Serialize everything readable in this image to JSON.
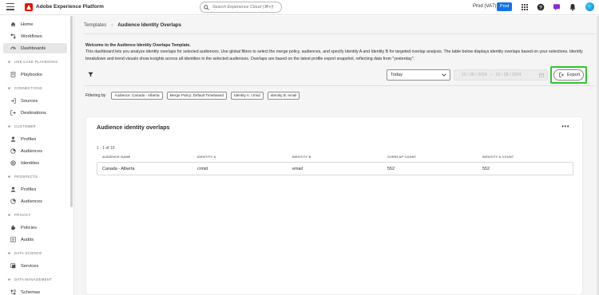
{
  "app": {
    "title": "Adobe Experience Platform",
    "search_placeholder": "Search Experience Cloud (⌘+/)",
    "org": "Prod (VA7)",
    "sandbox_badge": "Prod",
    "accent_color": "#1473e6",
    "brand_color": "#eb1000"
  },
  "sidebar": {
    "items_top": [
      {
        "label": "Home",
        "icon": "home-icon"
      },
      {
        "label": "Workflows",
        "icon": "workflows-icon"
      },
      {
        "label": "Dashboards",
        "icon": "dashboards-icon",
        "active": true
      }
    ],
    "sections": [
      {
        "label": "USE CASE PLAYBOOKS",
        "items": [
          {
            "label": "Playbooks",
            "icon": "playbooks-icon"
          }
        ]
      },
      {
        "label": "CONNECTIONS",
        "items": [
          {
            "label": "Sources",
            "icon": "sources-icon"
          },
          {
            "label": "Destinations",
            "icon": "destinations-icon"
          }
        ]
      },
      {
        "label": "CUSTOMER",
        "items": [
          {
            "label": "Profiles",
            "icon": "profiles-icon"
          },
          {
            "label": "Audiences",
            "icon": "audiences-icon"
          },
          {
            "label": "Identities",
            "icon": "identities-icon"
          }
        ]
      },
      {
        "label": "PROSPECTS",
        "items": [
          {
            "label": "Profiles",
            "icon": "profiles-icon"
          },
          {
            "label": "Audiences",
            "icon": "audiences-icon"
          }
        ]
      },
      {
        "label": "PRIVACY",
        "items": [
          {
            "label": "Policies",
            "icon": "policies-icon"
          },
          {
            "label": "Audits",
            "icon": "audits-icon"
          }
        ]
      },
      {
        "label": "DATA SCIENCE",
        "items": [
          {
            "label": "Services",
            "icon": "services-icon"
          }
        ]
      },
      {
        "label": "DATA MANAGEMENT",
        "items": [
          {
            "label": "Schemas",
            "icon": "schemas-icon"
          }
        ]
      }
    ]
  },
  "breadcrumb": {
    "parent": "Templates",
    "current": "Audience Identity Overlaps"
  },
  "welcome": {
    "heading": "Welcome to the Audience Identity Overlaps Template.",
    "body": "This dashboard lets you analyze identity overlaps for selected audiences. Use global filters to select the merge policy, audiences, and specify Identity A and Identity B for targeted overlap analysis. The table below displays identity overlaps based on your selections. Identity breakdown and trend visuals show insights across all identities in the selected audiences. Overlaps are based on the latest profile export snapshot, reflecting data from \"yesterday\"."
  },
  "toolbar": {
    "date_preset": "Today",
    "date_from": "10 / 28 / 2024",
    "date_to": "10 / 28 / 2024",
    "date_separator": "–",
    "export_label": "Export",
    "highlight_color": "#2fc52f"
  },
  "filters": {
    "label": "Filtering by",
    "chips": [
      "Audience: Canada - Alberta",
      "Merge Policy: Default Timebased",
      "Identity A: crmid",
      "Identity B: email"
    ]
  },
  "card": {
    "title": "Audience identity overlaps",
    "more": "•••",
    "count": "1 - 1 of 10",
    "columns": [
      "AUDIENCE NAME",
      "IDENTITY A",
      "IDENTITY B",
      "OVERLAP COUNT",
      "IDENTITY A COUNT"
    ],
    "rows": [
      [
        "Canada - Alberta",
        "crmid",
        "email",
        "552",
        "552"
      ]
    ]
  }
}
